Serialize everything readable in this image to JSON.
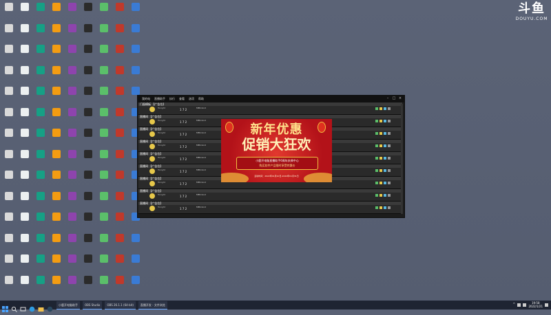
{
  "watermark": {
    "brand_cn": "斗鱼",
    "brand_en": "DOUYU.COM"
  },
  "window": {
    "menu": [
      "我的电",
      "直播助手",
      "执行",
      "查看",
      "选项",
      "帮助"
    ],
    "rows": [
      {
        "name": "门面模板 【广告位】",
        "meta": "Tonight",
        "num": "1 7 2",
        "info": "MBS bind"
      },
      {
        "name": "直播间 【广告位】",
        "meta": "Tonight",
        "num": "1 7 2",
        "info": "MBS bind"
      },
      {
        "name": "直播间 【广告位】",
        "meta": "Tonight",
        "num": "1 7 2",
        "info": "MBS bind"
      },
      {
        "name": "直播间 【广告位】",
        "meta": "Tonight",
        "num": "1 7 2",
        "info": "MBS bind"
      },
      {
        "name": "直播间 【广告位】",
        "meta": "Tonight",
        "num": "1 7 2",
        "info": "MBS bind"
      },
      {
        "name": "直播间 【广告位】",
        "meta": "Tonight",
        "num": "1 7 2",
        "info": "MBS bind"
      },
      {
        "name": "直播间 【广告位】",
        "meta": "Tonight",
        "num": "1 7 2",
        "info": "MBS bind"
      },
      {
        "name": "直播间 【广告位】",
        "meta": "Tonight",
        "num": "1 7 2",
        "info": "MBS bind"
      },
      {
        "name": "直播间 【广告位】",
        "meta": "Tonight",
        "num": "1 7 2",
        "info": "MBS bind"
      }
    ]
  },
  "banner": {
    "title_1": "新年优惠",
    "title_2": "促销大狂欢",
    "line_1": "小鹿开电脑直播助手6周年庆典中心",
    "line_2": "购买软件产品限时享受特惠价",
    "footer": "活动时间：2022年01月10日-2022年01月31日"
  },
  "taskbar": {
    "apps": [
      "小鹿开电脑助手",
      "OBS Studio",
      "OBS 26.1.1 (64-bit)",
      "直播开发 - 文件浏览"
    ],
    "time": "19:58",
    "date": "2022/1/21"
  },
  "colors": {
    "banner_red": "#c8161d",
    "accent_gold": "#f1c040",
    "taskbar": "#1e2432"
  }
}
